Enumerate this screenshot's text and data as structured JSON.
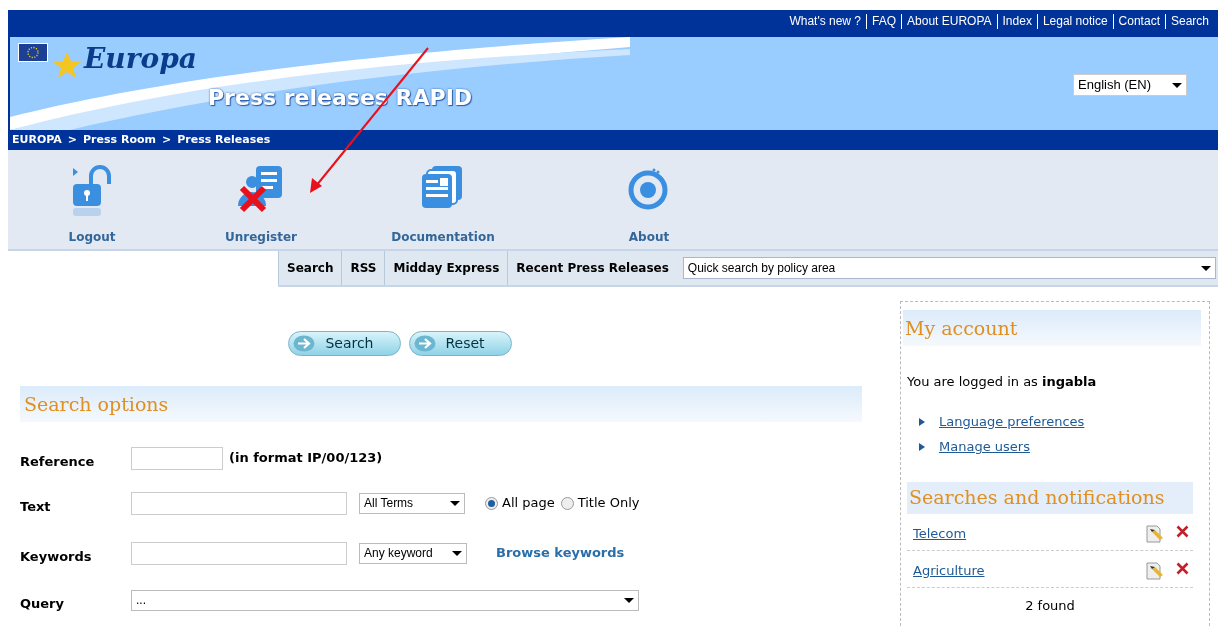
{
  "top_links": [
    "What's new ?",
    "FAQ",
    "About EUROPA",
    "Index",
    "Legal notice",
    "Contact",
    "Search"
  ],
  "banner": {
    "logo": "Europa",
    "title": "Press releases RAPID",
    "language": "English (EN)"
  },
  "breadcrumb": {
    "items": [
      "EUROPA",
      "Press Room",
      "Press Releases"
    ],
    "separator": ">"
  },
  "toolbar": [
    {
      "label": "Logout",
      "kind": "logout"
    },
    {
      "label": "Unregister",
      "kind": "unregister"
    },
    {
      "label": "Documentation",
      "kind": "documentation"
    },
    {
      "label": "About",
      "kind": "about"
    }
  ],
  "tabs": [
    {
      "label": "Search",
      "selected": false
    },
    {
      "label": "RSS",
      "selected": false
    },
    {
      "label": "Midday Express",
      "selected": false
    },
    {
      "label": "Recent Press Releases",
      "selected": false
    }
  ],
  "quick_search": {
    "value": "Quick search by policy area"
  },
  "buttons": [
    "Search",
    "Reset"
  ],
  "search_options": {
    "title": "Search options",
    "fields": [
      {
        "kind": "reference",
        "label": "Reference",
        "hint": "(in format IP/00/123)"
      },
      {
        "kind": "text",
        "label": "Text",
        "match": "All Terms",
        "radios": [
          {
            "label": "All page",
            "selected": true
          },
          {
            "label": "Title Only",
            "selected": false
          }
        ]
      },
      {
        "kind": "keywords",
        "label": "Keywords",
        "match": "Any keyword",
        "link": "Browse keywords"
      },
      {
        "kind": "query",
        "label": "Query",
        "value": "..."
      }
    ]
  },
  "account": {
    "title": "My account",
    "logged_in": "You are logged in as **ingabla**",
    "links": [
      "Language preferences",
      "Manage users"
    ]
  },
  "searches": {
    "title": "Searches and notifications",
    "items": [
      "Telecom",
      "Agriculture"
    ],
    "count": "2 found"
  }
}
